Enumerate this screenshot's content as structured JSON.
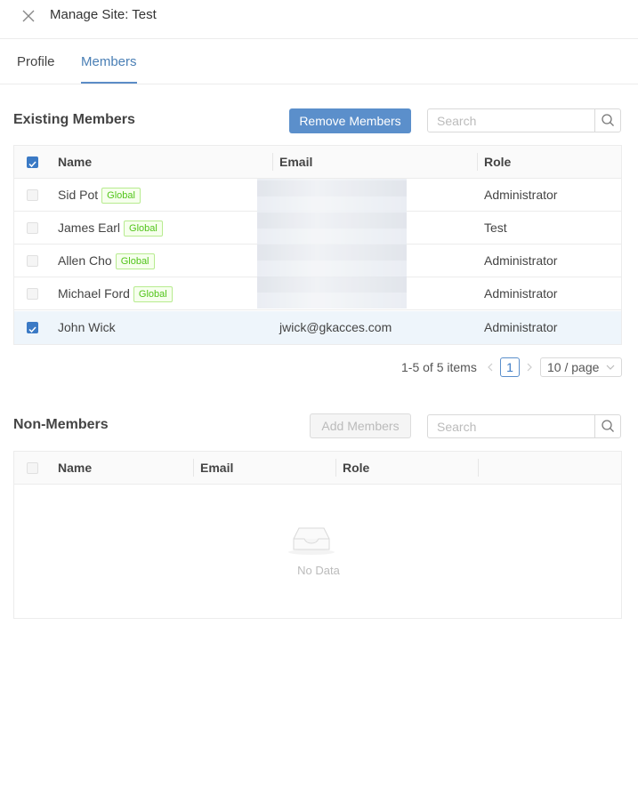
{
  "header": {
    "title": "Manage Site: Test",
    "close_icon": "close-icon"
  },
  "tabs": [
    {
      "label": "Profile"
    },
    {
      "label": "Members",
      "active": true
    }
  ],
  "existing": {
    "title": "Existing Members",
    "remove_button": "Remove Members",
    "search_placeholder": "Search",
    "columns": [
      "Name",
      "Email",
      "Role"
    ],
    "rows": [
      {
        "name": "Sid Pot",
        "tag": "Global",
        "email": "",
        "role": "Administrator",
        "checked": false
      },
      {
        "name": "James Earl",
        "tag": "Global",
        "email": "",
        "role": "Test",
        "checked": false
      },
      {
        "name": "Allen Cho",
        "tag": "Global",
        "email": "",
        "role": "Administrator",
        "checked": false
      },
      {
        "name": "Michael Ford",
        "tag": "Global",
        "email": "",
        "role": "Administrator",
        "checked": false
      },
      {
        "name": "John Wick",
        "tag": "",
        "email": "jwick@gkacces.com",
        "role": "Administrator",
        "checked": true
      }
    ],
    "pagination": {
      "summary": "1-5 of 5 items",
      "current_page": "1",
      "page_size": "10 / page"
    }
  },
  "nonmembers": {
    "title": "Non-Members",
    "add_button": "Add Members",
    "search_placeholder": "Search",
    "columns": [
      "Name",
      "Email",
      "Role"
    ],
    "empty_text": "No Data"
  },
  "colors": {
    "primary": "#5b8fcb",
    "tag_green": "#52c41a",
    "selected_row": "#eef5fb"
  }
}
